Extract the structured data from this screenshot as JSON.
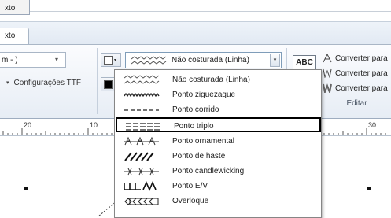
{
  "title_tab": {
    "label": "xto"
  },
  "ribbon_tab": {
    "label": "xto"
  },
  "font_combo": {
    "value": "m - )"
  },
  "ttf_settings": {
    "label": "Configurações TTF"
  },
  "stitch_combo": {
    "value": "Não costurada (Linha)"
  },
  "convert": {
    "items": [
      {
        "label": "Converter para"
      },
      {
        "label": "Converter para"
      },
      {
        "label": "Converter para"
      }
    ],
    "group_label": "Editar"
  },
  "abc_button": {
    "label": "ABC"
  },
  "ruler": {
    "numbers": [
      "20",
      "10",
      "30"
    ]
  },
  "dropdown": {
    "selected_index": 3,
    "items": [
      {
        "label": "Não costurada (Linha)",
        "icon": "zigzag-flat-icon"
      },
      {
        "label": "Ponto ziguezague",
        "icon": "zigzag-icon"
      },
      {
        "label": "Ponto corrido",
        "icon": "dashed-line-icon"
      },
      {
        "label": "Ponto triplo",
        "icon": "triple-line-icon"
      },
      {
        "label": "Ponto ornamental",
        "icon": "ornamental-icon"
      },
      {
        "label": "Ponto de haste",
        "icon": "stem-icon"
      },
      {
        "label": "Ponto candlewicking",
        "icon": "candlewick-icon"
      },
      {
        "label": "Ponto E/V",
        "icon": "ev-stitch-icon"
      },
      {
        "label": "Overloque",
        "icon": "overlock-icon"
      }
    ]
  },
  "colors": {
    "accent": "#000000",
    "ribbon": "#e7edf5",
    "swatch_top": "#ffffff",
    "swatch_bottom": "#000000"
  }
}
